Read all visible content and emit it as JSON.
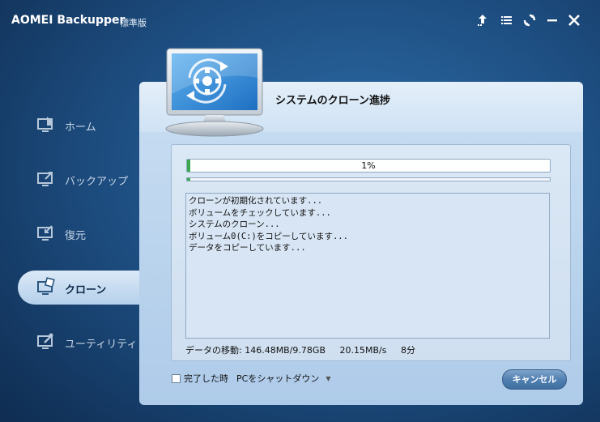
{
  "window": {
    "title": "AOMEI Backupper",
    "edition": "標準版",
    "controls": [
      {
        "name": "upgrade-icon"
      },
      {
        "name": "menu-icon"
      },
      {
        "name": "refresh-icon"
      },
      {
        "name": "minimize-icon"
      },
      {
        "name": "close-icon"
      }
    ]
  },
  "sidebar": {
    "items": [
      {
        "label": "ホーム",
        "icon": "home-icon",
        "active": false
      },
      {
        "label": "バックアップ",
        "icon": "backup-icon",
        "active": false
      },
      {
        "label": "復元",
        "icon": "restore-icon",
        "active": false
      },
      {
        "label": "クローン",
        "icon": "clone-icon",
        "active": true
      },
      {
        "label": "ユーティリティ",
        "icon": "utilities-icon",
        "active": false
      }
    ]
  },
  "main": {
    "title": "システムのクローン進捗",
    "progress": {
      "percent_label": "1%",
      "value": 0.01
    },
    "log": [
      "クローンが初期化されています...",
      "ボリュームをチェックしています...",
      "システムのクローン...",
      "ボリューム0(C:)をコピーしています...",
      "データをコピーしています..."
    ],
    "status": {
      "transfer": "データの移動: 146.48MB/9.78GB",
      "speed": "20.15MB/s",
      "time": "8分"
    },
    "shutdown": {
      "label": "完了した時",
      "option": "PCをシャットダウン",
      "checked": false
    },
    "cancel_label": "キャンセル"
  },
  "colors": {
    "accent_green": "#3aa84c",
    "panel_blue": "#aecbe9",
    "background_dark": "#113259"
  }
}
